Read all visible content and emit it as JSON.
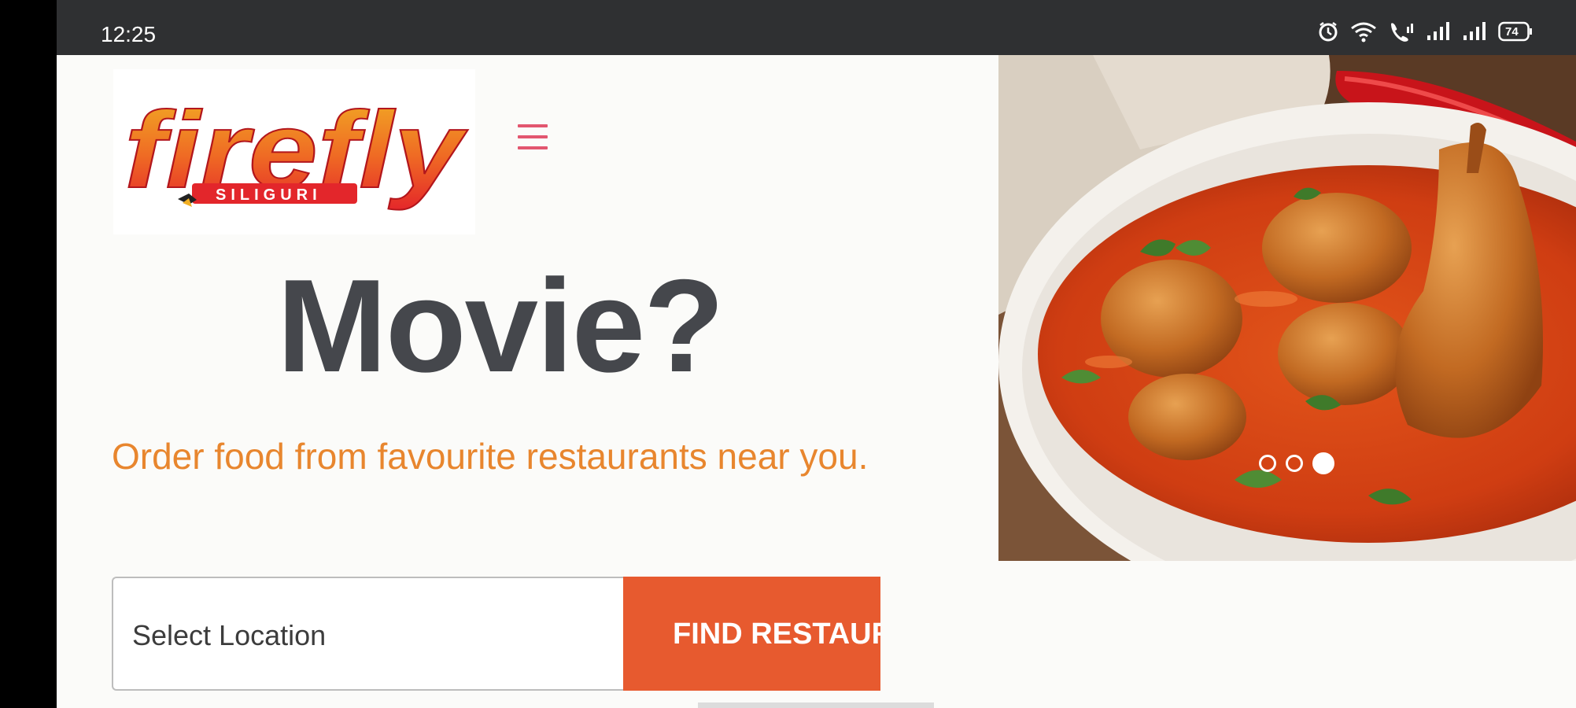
{
  "status_bar": {
    "time": "12:25",
    "icons": [
      "alarm-icon",
      "wifi-icon",
      "call-icon",
      "signal-icon",
      "signal-icon",
      "battery-icon"
    ],
    "battery_level": "74"
  },
  "header": {
    "logo_text": "firefly",
    "logo_subtext": "SILIGURI",
    "menu_icon": "hamburger-menu-icon"
  },
  "hero": {
    "headline": "Movie?",
    "tagline": "Order food from favourite restaurants near you.",
    "image_alt": "bowl of chicken curry",
    "carousel": {
      "count": 3,
      "active_index": 2
    }
  },
  "search": {
    "placeholder": "Select Location",
    "button_label": "FIND RESTAURANTS"
  },
  "colors": {
    "accent_orange": "#e75a2f",
    "tagline_orange": "#e8862e",
    "headline_gray": "#45474c",
    "menu_pink": "#e2566f",
    "status_bar": "#2f3032"
  }
}
